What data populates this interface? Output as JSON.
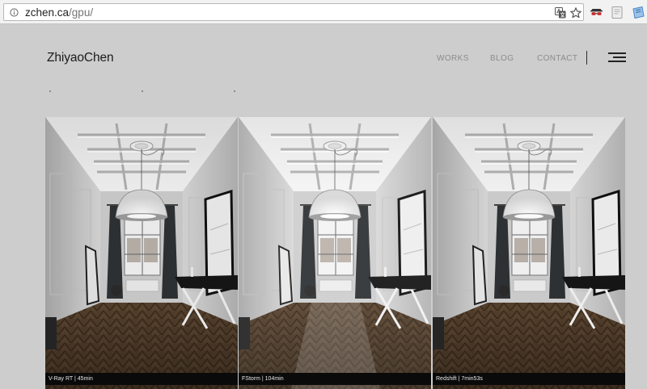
{
  "browser": {
    "url_host": "zchen.ca",
    "url_path": "/gpu/"
  },
  "site": {
    "logo": "ZhiyaoChen",
    "nav": [
      {
        "label": "WORKS"
      },
      {
        "label": "BLOG"
      },
      {
        "label": "CONTACT"
      }
    ],
    "menu_icon": "hamburger-icon"
  },
  "renders": [
    {
      "caption": "V-Ray RT | 45min"
    },
    {
      "caption": "FStorm | 104min"
    },
    {
      "caption": "Redshift | 7min53s"
    }
  ]
}
